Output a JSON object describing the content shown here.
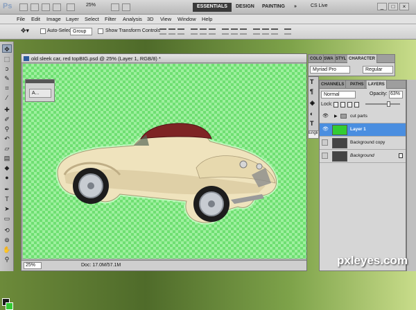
{
  "app": {
    "logo": "Ps",
    "zoom": "25%",
    "workspaces": [
      "ESSENTIALS",
      "DESIGN",
      "PAINTING",
      "»"
    ],
    "cslive": "CS Live"
  },
  "menu": [
    "File",
    "Edit",
    "Image",
    "Layer",
    "Select",
    "Filter",
    "Analysis",
    "3D",
    "View",
    "Window",
    "Help"
  ],
  "options": {
    "auto_select_label": "Auto-Select:",
    "auto_select_value": "Group",
    "show_transform_label": "Show Transform Controls"
  },
  "document": {
    "title": "old sleek car, red topBIG.psd @ 25% (Layer 1, RGB/8) *",
    "zoom": "25%",
    "doc_info": "Doc: 17.0M/57.1M"
  },
  "float_panel": {
    "button_label": "A..."
  },
  "character_panel": {
    "tabs": [
      "COLO",
      "SWA",
      "STYL",
      "CHARACTER"
    ],
    "font_family": "Myriad Pro",
    "font_style": "Regular"
  },
  "english_label": "Engli",
  "layers_panel": {
    "tabs": [
      "CHANNELS",
      "PATHS",
      "LAYERS"
    ],
    "blend_mode": "Normal",
    "opacity_label": "Opacity:",
    "opacity_value": "63%",
    "lock_label": "Lock:",
    "layers": [
      {
        "name": "cut parts",
        "type": "group",
        "visible": true,
        "selected": false
      },
      {
        "name": "Layer 1",
        "type": "layer",
        "visible": true,
        "selected": true
      },
      {
        "name": "Background copy",
        "type": "layer",
        "visible": false,
        "selected": false
      },
      {
        "name": "Background",
        "type": "layer",
        "visible": false,
        "selected": false,
        "italic": true,
        "locked": true
      }
    ]
  },
  "watermark": "pxleyes.com",
  "colors": {
    "foreground": "#1a1a1a",
    "background": "#33cc33",
    "selected_layer": "#4a8ee0",
    "transparency_checker": "#6fdf72"
  }
}
